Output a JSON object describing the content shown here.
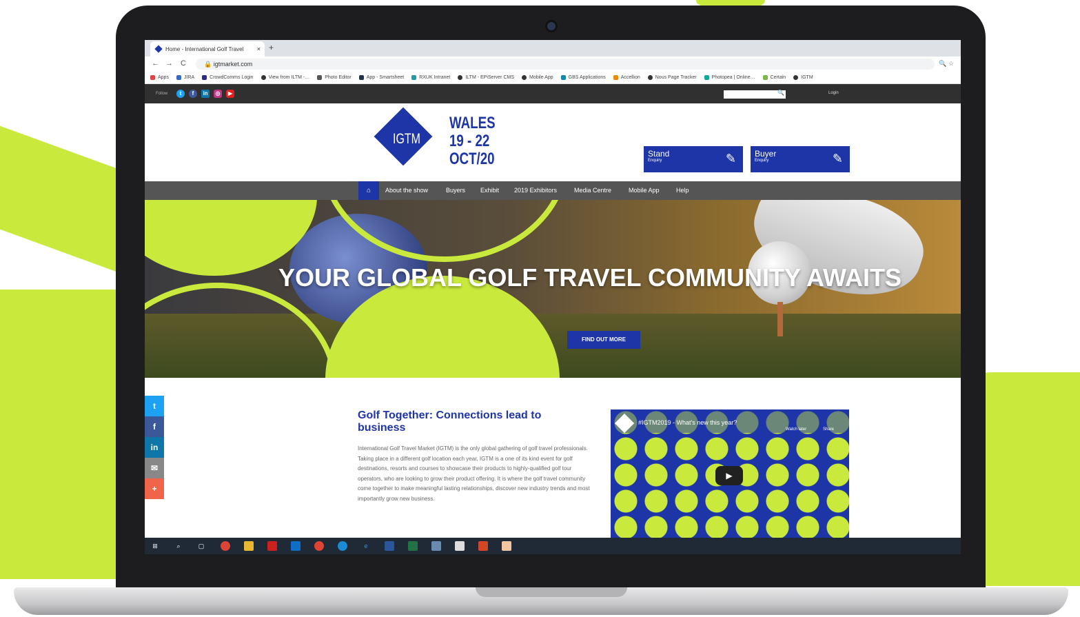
{
  "colors": {
    "brand_blue": "#1e35a8",
    "lime": "#c9ea3c",
    "nav_grey": "#555555",
    "topbar": "#303030"
  },
  "browser": {
    "tab_title": "Home - International Golf Travel",
    "tab_close": "×",
    "new_tab": "+",
    "back": "←",
    "forward": "→",
    "reload": "C",
    "url": "igtmarket.com",
    "bookmarks": [
      "Apps",
      "JIRA",
      "CrowdComms Login",
      "View from ILTM -…",
      "Photo Editor",
      "App - Smartsheet",
      "RXUK Intranet",
      "ILTM - EPiServer CMS",
      "Mobile App",
      "GBS Applications",
      "Accellion",
      "Nous Page Tracker",
      "Photopea | Online…",
      "Certain",
      "IGTM"
    ]
  },
  "site": {
    "follow_label": "Follow",
    "social_icons": [
      "twitter-icon",
      "facebook-icon",
      "linkedin-icon",
      "instagram-icon",
      "youtube-icon"
    ],
    "login": "Login",
    "logo": {
      "text": "IGTM",
      "line1": "WALES",
      "line2": "19 - 22",
      "line3": "OCT/20"
    },
    "stand_btn": {
      "main": "Stand",
      "sub": "Enquiry"
    },
    "buyer_btn": {
      "main": "Buyer",
      "sub": "Enquiry"
    },
    "nav": [
      "About the show",
      "Buyers",
      "Exhibit",
      "2019 Exhibitors",
      "Media Centre",
      "Mobile App",
      "Help"
    ],
    "hero_title": "YOUR GLOBAL GOLF TRAVEL COMMUNITY AWAITS",
    "hero_cta": "FIND OUT MORE",
    "article_title": "Golf Together: Connections lead to business",
    "article_body": "International Golf Travel Market (IGTM) is the only global gathering of golf travel professionals. Taking place in a different golf location each year, IGTM is a one of its kind event for golf destinations, resorts and courses to showcase their products to highly-qualified golf tour operators, who are looking to grow their product offering. It is where the golf travel community come together to make meaningful lasting relationships, discover new industry trends and most importantly grow new business.",
    "video_title": "#IGTM2019 - What's new this year?",
    "video_watch": "Watch later",
    "video_share": "Share",
    "share_buttons": [
      "twitter",
      "facebook",
      "linkedin",
      "email",
      "more"
    ]
  }
}
